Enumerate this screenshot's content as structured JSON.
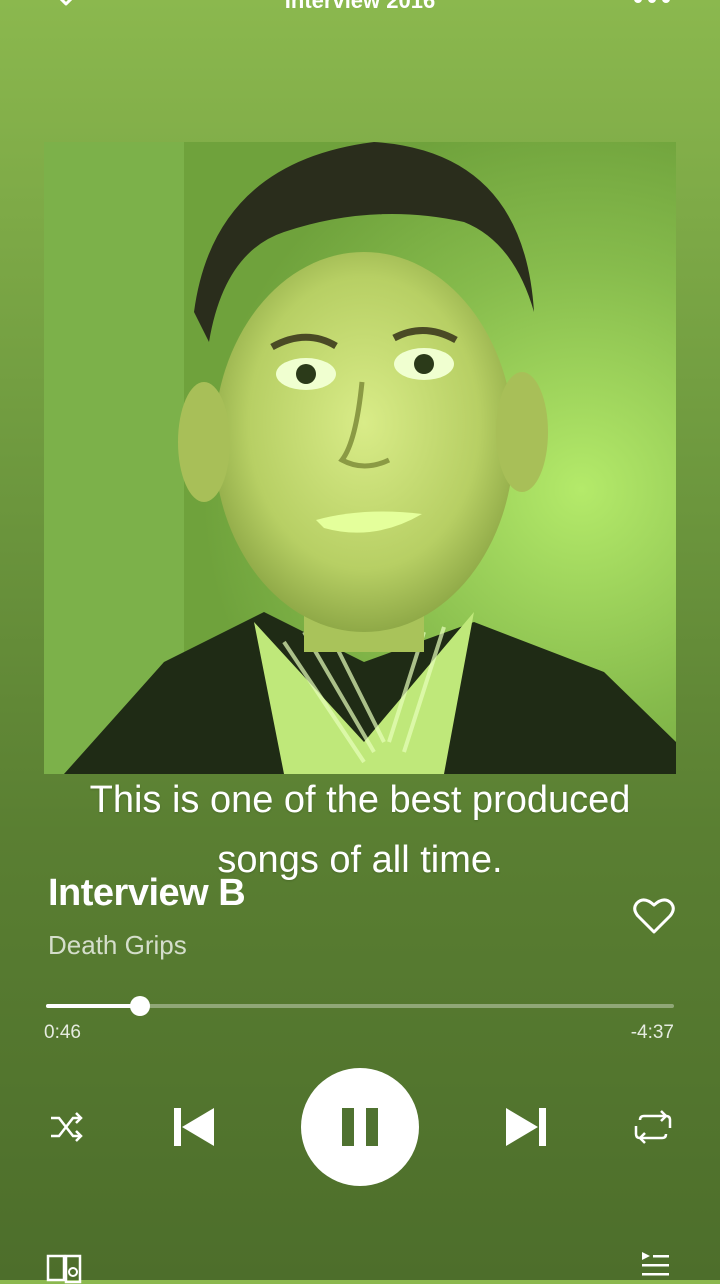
{
  "header": {
    "title": "Interview 2016",
    "collapse_icon": "chevron-down-icon",
    "more_icon": "more-horizontal-icon"
  },
  "caption": {
    "text": "This is one of the best produced songs of all time."
  },
  "track": {
    "title": "Interview B",
    "artist": "Death Grips",
    "liked_icon": "heart-outline-icon"
  },
  "playback": {
    "elapsed": "0:46",
    "remaining": "-4:37",
    "progress_fraction": 0.15,
    "state": "playing"
  },
  "controls": {
    "shuffle_icon": "shuffle-icon",
    "previous_icon": "skip-previous-icon",
    "play_pause_icon": "pause-icon",
    "next_icon": "skip-next-icon",
    "repeat_icon": "repeat-icon"
  },
  "footer": {
    "devices_icon": "devices-icon",
    "queue_icon": "queue-icon"
  },
  "colors": {
    "background_top": "#8bb84e",
    "background_bottom": "#4d6e2b",
    "foreground": "#ffffff"
  }
}
